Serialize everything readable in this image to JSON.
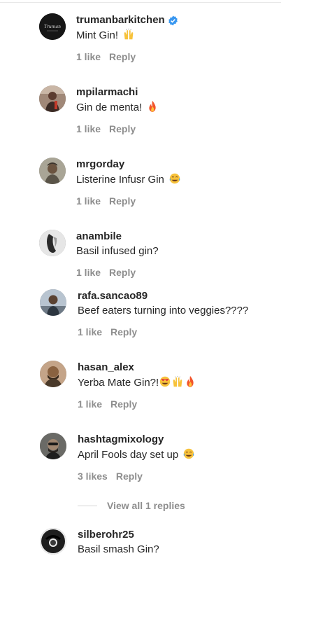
{
  "comments": [
    {
      "username": "trumanbarkitchen",
      "verified": true,
      "text": "Mint Gin!",
      "emojis": [
        "raised-hands"
      ],
      "likes": "1 like",
      "reply": "Reply",
      "avatar_color": "#1a1a1a"
    },
    {
      "username": "mpilarmachi",
      "verified": false,
      "text": "Gin de menta!",
      "emojis": [
        "fire"
      ],
      "likes": "1 like",
      "reply": "Reply",
      "avatar_color": "#6b5a55"
    },
    {
      "username": "mrgorday",
      "verified": false,
      "text": "Listerine Infusr Gin",
      "emojis": [
        "tears-of-joy"
      ],
      "likes": "1 like",
      "reply": "Reply",
      "avatar_color": "#8a8676"
    },
    {
      "username": "anambile",
      "verified": false,
      "text": "Basil infused gin?",
      "emojis": [],
      "likes": "1 like",
      "reply": "Reply",
      "avatar_color": "#d8d8d8"
    },
    {
      "username": "rafa.sancao89",
      "verified": false,
      "text": "Beef eaters turning into veggies????",
      "emojis": [],
      "likes": "1 like",
      "reply": "Reply",
      "avatar_color": "#9aa6b4"
    },
    {
      "username": "hasan_alex",
      "verified": false,
      "text": "Yerba Mate Gin?!",
      "emojis": [
        "heart-eyes",
        "raised-hands",
        "fire"
      ],
      "likes": "1 like",
      "reply": "Reply",
      "avatar_color": "#7a5a3a"
    },
    {
      "username": "hashtagmixology",
      "verified": false,
      "text": "April Fools day set up",
      "emojis": [
        "tears-of-joy"
      ],
      "likes": "3 likes",
      "reply": "Reply",
      "avatar_color": "#4a4a48"
    },
    {
      "username": "silberohr25",
      "verified": false,
      "text": "Basil smash Gin?",
      "emojis": [],
      "likes": "",
      "reply": "",
      "avatar_color": "#2a2a2a"
    }
  ],
  "view_all_replies": "View all 1 replies",
  "colors": {
    "text": "#262626",
    "meta": "#8e8e8e",
    "verified": "#3897f0"
  }
}
